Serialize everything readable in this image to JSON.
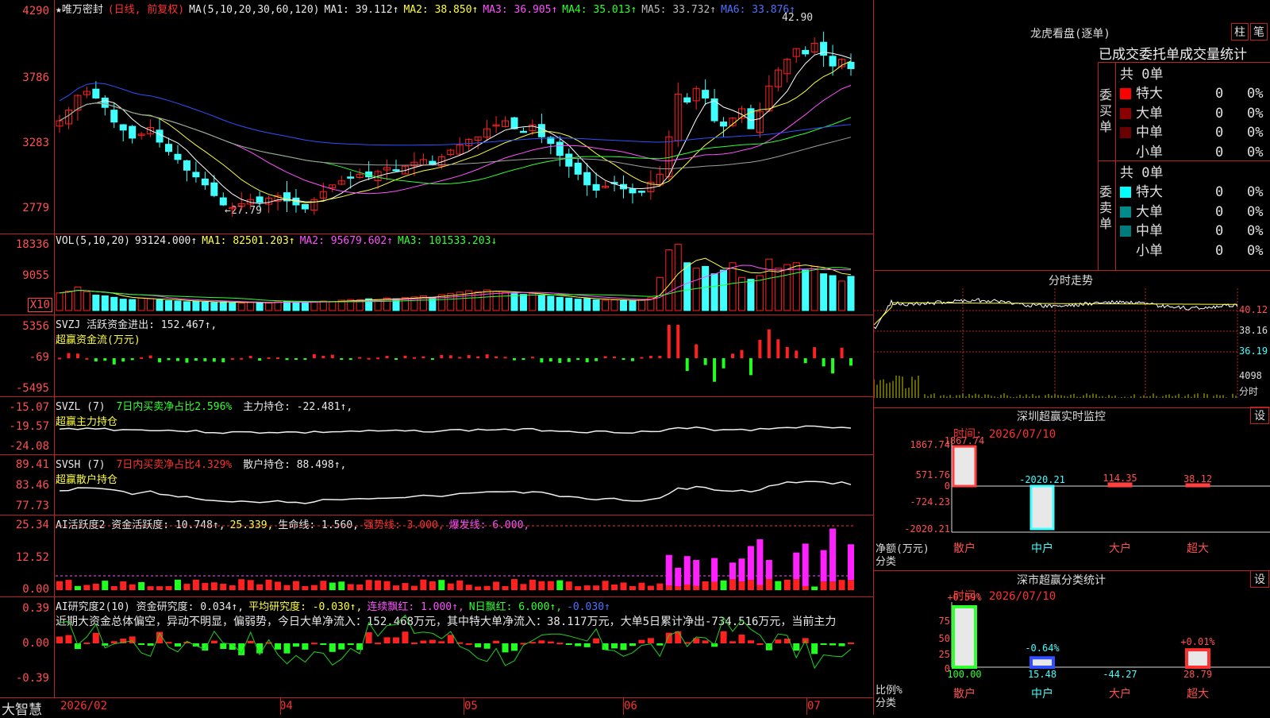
{
  "app": {
    "logo": "大智慧"
  },
  "price_panel": {
    "title": "★唯万密封",
    "mode": "(日线, 前复权)",
    "ma_params": "MA(5,10,20,30,60,120)",
    "ma1": "MA1: 39.112↑",
    "ma2": "MA2: 38.850↑",
    "ma3": "MA3: 36.905↑",
    "ma4": "MA4: 35.013↑",
    "ma5": "MA5: 33.732↑",
    "ma6": "MA6: 33.876↑",
    "y_ticks": [
      "4290",
      "3786",
      "3283",
      "2779"
    ],
    "hi_label": "42.90",
    "lo_label": "←27.79"
  },
  "vol_panel": {
    "label": "VOL(5,10,20)",
    "value": "93124.000↑",
    "ma1": "MA1: 82501.203↑",
    "ma2": "MA2: 95679.602↑",
    "ma3": "MA3: 101533.203↓",
    "y_ticks": [
      "18336",
      "9055"
    ],
    "unit": "X10"
  },
  "svzj_panel": {
    "line1": "SVZJ  活跃资金进出: 152.467↑,",
    "line2": "超赢资金流(万元)",
    "y_ticks": [
      "5356",
      "-69",
      "-5495"
    ]
  },
  "svzl_panel": {
    "line1a": "SVZL (7) ",
    "line1b": "7日内买卖净占比2.596%",
    "line1c": " 主力持仓: -22.481↑,",
    "line2": "超赢主力持仓",
    "y_ticks": [
      "-15.07",
      "-19.57",
      "-24.08"
    ]
  },
  "svsh_panel": {
    "line1a": "SVSH (7) ",
    "line1b": "7日内买卖净占比4.329%",
    "line1c": " 散户持仓: 88.498↑,",
    "line2": "超赢散户持仓",
    "y_ticks": [
      "89.41",
      "83.46",
      "77.73"
    ]
  },
  "ai_active_panel": {
    "label": "AI活跃度2 资金活跃度: 10.748↑,",
    "v2": "25.339,",
    "v3": "生命线: 1.560,",
    "v4": "强势线: 3.000,",
    "v5": "爆发线: 6.000,",
    "y_ticks": [
      "25.34",
      "12.52",
      "0.00"
    ]
  },
  "ai_research_panel": {
    "label": "AI研究度2(10) 资金研究度: 0.034↑,",
    "v2": "平均研究度: -0.030↑,",
    "v3": "连续飘红: 1.000↑,",
    "v4": "N日飘红: 6.000↑,",
    "v5": "-0.030↑",
    "commentary": "近期大资金总体偏空，异动不明显，偏弱势，今日大单净流入：152.468万元，其中特大单净流入：38.117万元，大单5日累计净出-734.516万元，当前主力",
    "y_ticks": [
      "0.39",
      "0.00",
      "-0.39"
    ]
  },
  "x_axis": {
    "labels": [
      "2026/02",
      "04",
      "05",
      "06",
      "07"
    ]
  },
  "dragon_tiger": {
    "title": "龙虎看盘(逐单)",
    "btn_bar": "柱",
    "btn_pen": "笔",
    "tabs": [
      "已成交",
      "委托单",
      "成交量",
      "统计"
    ],
    "buy": {
      "label": "委买单",
      "total": "共 0单",
      "rows": [
        {
          "name": "特大",
          "count": "0",
          "pct": "0%",
          "color": "#ff0000"
        },
        {
          "name": "大单",
          "count": "0",
          "pct": "0%",
          "color": "#8b0000"
        },
        {
          "name": "中单",
          "count": "0",
          "pct": "0%",
          "color": "#6b0000"
        },
        {
          "name": "小单",
          "count": "0",
          "pct": "0%",
          "color": "#000000"
        }
      ]
    },
    "sell": {
      "label": "委卖单",
      "total": "共 0单",
      "rows": [
        {
          "name": "特大",
          "count": "0",
          "pct": "0%",
          "color": "#00ffff"
        },
        {
          "name": "大单",
          "count": "0",
          "pct": "0%",
          "color": "#008b8b"
        },
        {
          "name": "中单",
          "count": "0",
          "pct": "0%",
          "color": "#007b7b"
        },
        {
          "name": "小单",
          "count": "0",
          "pct": "0%",
          "color": "#000000"
        }
      ]
    }
  },
  "intraday": {
    "title": "分时走势",
    "y_ticks": [
      "40.12",
      "38.16",
      "36.19"
    ],
    "vol_tick": "4098",
    "footer": "分时"
  },
  "sz_monitor": {
    "title": "深圳超赢实时监控",
    "btn": "设",
    "time": "时间: 2026/07/10",
    "y_ticks": [
      "1867.74",
      "571.76",
      "0",
      "-724.23",
      "-2020.21"
    ],
    "values": [
      "1867.74",
      "-2020.21",
      "114.35",
      "38.12"
    ],
    "categories": [
      "散户",
      "中户",
      "大户",
      "超大"
    ],
    "ylabel": "净额(万元)",
    "xlabel": "分类"
  },
  "sz_class": {
    "title": "深市超赢分类统计",
    "btn": "设",
    "time": "时间: 2026/07/10",
    "y_ticks": [
      "75",
      "50",
      "25",
      "0"
    ],
    "top_labels": [
      "+0.59%",
      "-0.64%",
      "+0.01%"
    ],
    "values": [
      "100.00",
      "15.48",
      "-44.27",
      "28.79"
    ],
    "categories": [
      "散户",
      "中户",
      "大户",
      "超大"
    ],
    "ylabel": "比例%",
    "xlabel": "分类"
  },
  "chart_data": {
    "type": "candlestick",
    "ylim": [
      27.79,
      42.9
    ],
    "x_labels": [
      "2026/02",
      "04",
      "05",
      "06",
      "07"
    ],
    "series": [
      {
        "name": "MA1"
      },
      {
        "name": "MA2"
      },
      {
        "name": "MA3"
      },
      {
        "name": "MA4"
      },
      {
        "name": "MA5"
      },
      {
        "name": "MA6"
      }
    ],
    "closes": [
      35.2,
      36.0,
      37.1,
      37.4,
      36.9,
      36.2,
      35.1,
      34.5,
      33.9,
      34.2,
      34.7,
      33.6,
      32.9,
      32.3,
      31.5,
      31.0,
      30.4,
      29.6,
      28.9,
      28.7,
      29.0,
      29.3,
      29.1,
      29.4,
      29.6,
      29.2,
      28.9,
      28.6,
      29.3,
      29.9,
      30.4,
      30.7,
      30.9,
      31.2,
      31.0,
      31.4,
      31.7,
      31.5,
      31.8,
      32.1,
      32.3,
      31.9,
      32.5,
      33.0,
      33.4,
      33.8,
      34.0,
      34.6,
      34.9,
      35.2,
      34.6,
      34.4,
      34.9,
      34.0,
      33.5,
      32.6,
      31.8,
      31.2,
      30.4,
      30.0,
      30.3,
      30.5,
      30.1,
      29.8,
      29.9,
      30.6,
      31.2,
      34.0,
      37.2,
      36.6,
      37.6,
      36.9,
      35.2,
      34.8,
      35.4,
      36.1,
      34.6,
      35.9,
      37.8,
      39.0,
      39.8,
      40.6,
      40.2,
      41.0,
      40.1,
      39.3,
      39.8,
      39.1
    ],
    "volume": [
      4.8,
      5.3,
      6.4,
      5.1,
      4.2,
      4.0,
      3.6,
      3.1,
      3.0,
      3.4,
      3.2,
      2.9,
      2.7,
      2.6,
      2.4,
      2.5,
      2.3,
      2.2,
      2.4,
      2.1,
      2.0,
      2.3,
      2.2,
      2.1,
      2.4,
      2.5,
      2.3,
      2.2,
      2.4,
      2.6,
      2.5,
      2.8,
      3.0,
      2.9,
      3.2,
      3.0,
      3.4,
      3.2,
      3.5,
      3.7,
      4.0,
      3.6,
      4.3,
      4.6,
      5.0,
      5.4,
      5.1,
      5.6,
      5.2,
      4.9,
      4.6,
      4.4,
      4.7,
      4.2,
      3.9,
      3.6,
      3.4,
      3.1,
      3.3,
      2.9,
      2.8,
      2.9,
      2.7,
      2.6,
      3.0,
      3.5,
      9.0,
      16.5,
      18.0,
      13.0,
      11.5,
      12.0,
      10.0,
      11.0,
      13.0,
      9.0,
      8.5,
      9.5,
      14.0,
      11.5,
      12.5,
      13.0,
      11.0,
      12.0,
      10.0,
      9.5,
      8.0,
      9.3
    ]
  }
}
